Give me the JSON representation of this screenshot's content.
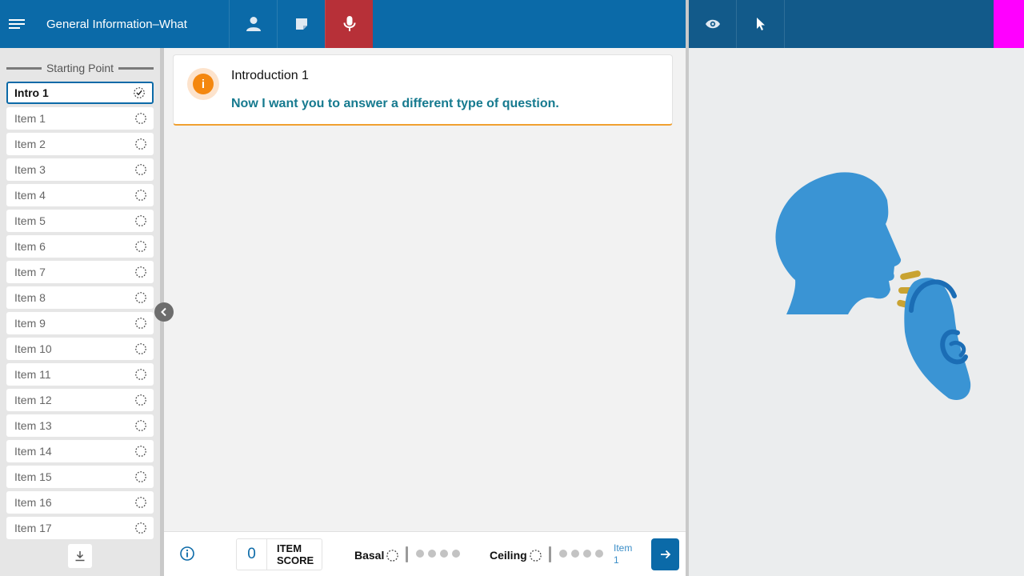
{
  "header": {
    "title": "General Information–What",
    "menu_icon": "hamburger-icon",
    "icons": [
      "person-icon",
      "sticky-note-icon",
      "microphone-icon"
    ],
    "active_icon": "microphone-icon",
    "right_icons": [
      "eye-icon",
      "pointer-icon"
    ]
  },
  "sidebar": {
    "section_label": "Starting Point",
    "items": [
      {
        "label": "Intro 1",
        "selected": true,
        "status": "check-circle-icon"
      },
      {
        "label": "Item 1",
        "status": "dashed-circle-icon"
      },
      {
        "label": "Item 2",
        "status": "dashed-circle-icon"
      },
      {
        "label": "Item 3",
        "status": "dashed-circle-icon"
      },
      {
        "label": "Item 4",
        "status": "dashed-circle-icon"
      },
      {
        "label": "Item 5",
        "status": "dashed-circle-icon"
      },
      {
        "label": "Item 6",
        "status": "dashed-circle-icon"
      },
      {
        "label": "Item 7",
        "status": "dashed-circle-icon"
      },
      {
        "label": "Item 8",
        "status": "dashed-circle-icon"
      },
      {
        "label": "Item 9",
        "status": "dashed-circle-icon"
      },
      {
        "label": "Item 10",
        "status": "dashed-circle-icon"
      },
      {
        "label": "Item 11",
        "status": "dashed-circle-icon"
      },
      {
        "label": "Item 12",
        "status": "dashed-circle-icon"
      },
      {
        "label": "Item 13",
        "status": "dashed-circle-icon"
      },
      {
        "label": "Item 14",
        "status": "dashed-circle-icon"
      },
      {
        "label": "Item 15",
        "status": "dashed-circle-icon"
      },
      {
        "label": "Item 16",
        "status": "dashed-circle-icon"
      },
      {
        "label": "Item 17",
        "status": "dashed-circle-icon"
      }
    ]
  },
  "card": {
    "badge": "i",
    "title": "Introduction 1",
    "text": "Now I want you to answer a different type of question."
  },
  "bottom": {
    "score_value": "0",
    "score_label_1": "ITEM",
    "score_label_2": "SCORE",
    "basal_label": "Basal",
    "ceiling_label": "Ceiling",
    "next_label_1": "Item",
    "next_label_2": "1"
  },
  "colors": {
    "primary": "#0b6aa8",
    "active_tab": "#b73038",
    "accent_orange": "#f4870f",
    "illustration_blue": "#3a94d4",
    "sound_lines": "#c9a332",
    "magenta": "#ff00ff"
  }
}
